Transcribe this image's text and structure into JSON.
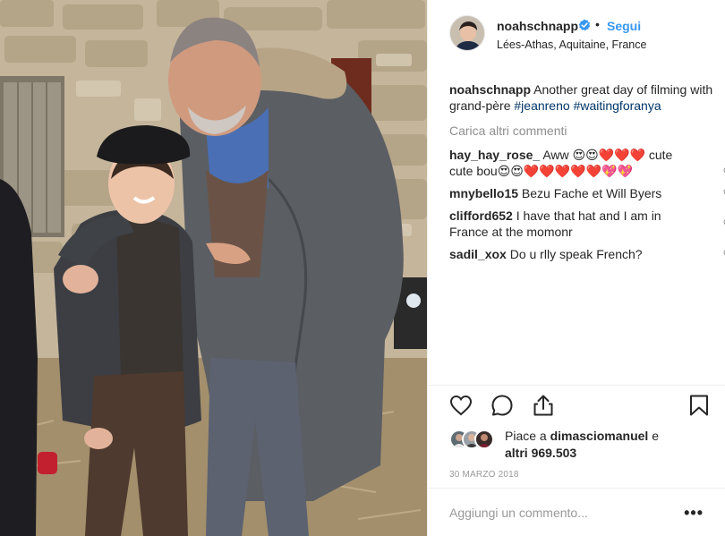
{
  "colors": {
    "accent": "#3897f0",
    "hashtag": "#003569",
    "muted": "#8e8e8e",
    "heart_red": "#ed4956"
  },
  "post": {
    "image_icon": "post-photo",
    "header": {
      "username": "noahschnapp",
      "verified_icon": "verified-badge-icon",
      "separator": "•",
      "follow_label": "Segui",
      "location": "Lées-Athas, Aquitaine, France"
    },
    "caption": {
      "username": "noahschnapp",
      "text": "Another great day of filming with grand-père",
      "hashtag1": "#jeanreno",
      "hashtag2": "#waitingforanya"
    },
    "load_more": "Carica altri commenti",
    "comments": [
      {
        "username": "hay_hay_rose_",
        "text": "Aww 😍😍❤️❤️❤️ cute cute bou😍😍❤️❤️❤️❤️❤️💖💖"
      },
      {
        "username": "mnybello15",
        "text": "Bezu Fache et Will Byers"
      },
      {
        "username": "clifford652",
        "text": "I have that hat and I am in France at the momonr"
      },
      {
        "username": "sadil_xox",
        "text": "Do u rlly speak French?"
      }
    ],
    "actions": {
      "like_icon": "heart-icon",
      "comment_icon": "comment-icon",
      "share_icon": "share-icon",
      "save_icon": "bookmark-icon"
    },
    "likes": {
      "prefix": "Piace a",
      "user": "dimasciomanuel",
      "conj": "e",
      "others": "altri 969.503"
    },
    "date": "30 MARZO 2018",
    "add_comment_placeholder": "Aggiungi un commento...",
    "more_label": "•••"
  }
}
